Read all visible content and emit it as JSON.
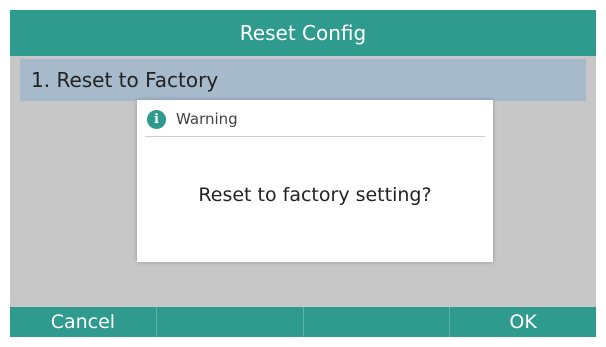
{
  "header": {
    "title": "Reset Config"
  },
  "menu": {
    "items": [
      {
        "label": "1. Reset to Factory",
        "selected": true
      }
    ]
  },
  "dialog": {
    "icon": "info-icon",
    "title": "Warning",
    "message": "Reset to factory setting?"
  },
  "softkeys": [
    {
      "label": "Cancel"
    },
    {
      "label": ""
    },
    {
      "label": ""
    },
    {
      "label": "OK"
    }
  ],
  "colors": {
    "accent": "#2f9a8e",
    "selection": "#a6bacb",
    "background": "#c7c7c7"
  }
}
